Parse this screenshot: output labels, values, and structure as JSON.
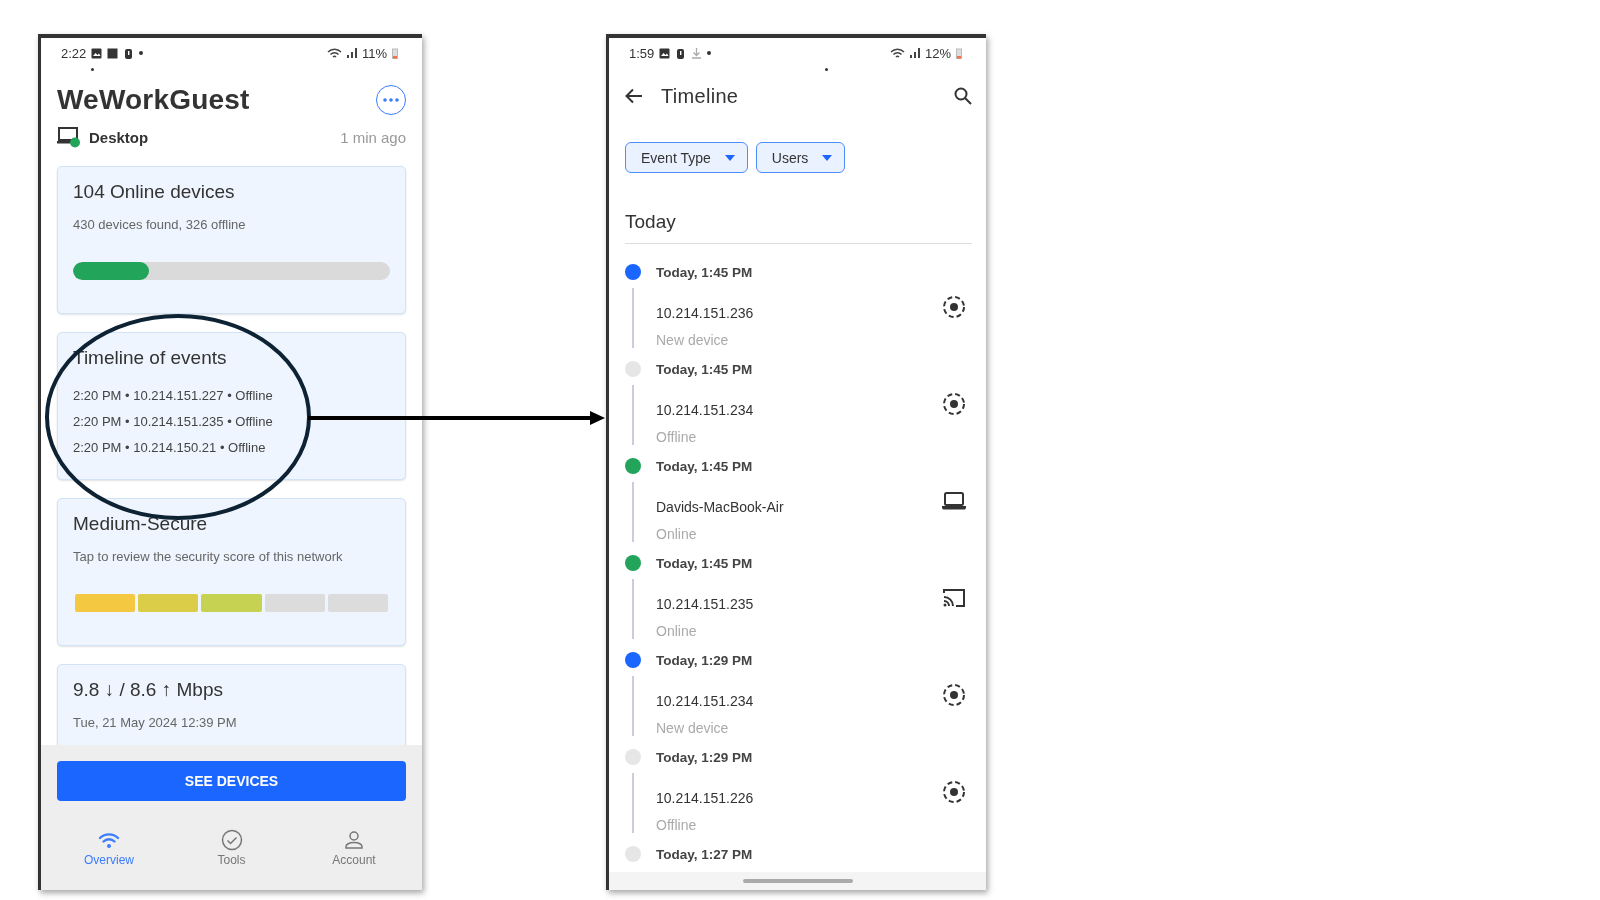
{
  "overview_screen": {
    "status_bar": {
      "time": "2:22",
      "battery": "11%"
    },
    "title": "WeWorkGuest",
    "device": {
      "name": "Desktop",
      "updated": "1 min ago"
    },
    "cards": [
      {
        "kind": "devices",
        "title": "104 Online devices",
        "subtitle": "430 devices found, 326 offline",
        "level": 0.24
      },
      {
        "kind": "timeline",
        "title": "Timeline of events",
        "lines": [
          "2:20 PM • 10.214.151.227 • Offline",
          "2:20 PM • 10.214.151.235 • Offline",
          "2:20 PM • 10.214.150.21 • Offline"
        ]
      },
      {
        "kind": "security",
        "title": "Medium-Secure",
        "subtitle": "Tap to review the security score of this network",
        "segments": [
          {
            "color": "#f5c842"
          },
          {
            "color": "#dccd48"
          },
          {
            "color": "#c5d252"
          },
          {
            "color": "#dcdcdc"
          },
          {
            "color": "#dcdcdc"
          }
        ]
      },
      {
        "kind": "speed",
        "title": "9.8 ↓ / 8.6 ↑ Mbps",
        "subtitle": "Tue, 21 May 2024 12:39 PM"
      }
    ],
    "primary_button": "SEE DEVICES",
    "nav": [
      {
        "label": "Overview",
        "kind": "wifi",
        "selected": true
      },
      {
        "label": "Tools",
        "kind": "check",
        "selected": false
      },
      {
        "label": "Account",
        "kind": "person",
        "selected": false
      }
    ]
  },
  "timeline_screen": {
    "status_bar": {
      "time": "1:59",
      "battery": "12%"
    },
    "title": "Timeline",
    "filters": [
      "Event Type",
      "Users"
    ],
    "section": "Today",
    "events": [
      {
        "time": "Today, 1:45 PM",
        "device": "10.214.151.236",
        "event": "New device",
        "color": "#1a66ff",
        "kind": "radar"
      },
      {
        "time": "Today, 1:45 PM",
        "device": "10.214.151.234",
        "event": "Offline",
        "color": "#e6e6e6",
        "kind": "radar"
      },
      {
        "time": "Today, 1:45 PM",
        "device": "Davids-MacBook-Air",
        "event": "Online",
        "color": "#22a55a",
        "kind": "laptop"
      },
      {
        "time": "Today, 1:45 PM",
        "device": "10.214.151.235",
        "event": "Online",
        "color": "#22a55a",
        "kind": "cast"
      },
      {
        "time": "Today, 1:29 PM",
        "device": "10.214.151.234",
        "event": "New device",
        "color": "#1a66ff",
        "kind": "radar"
      },
      {
        "time": "Today, 1:29 PM",
        "device": "10.214.151.226",
        "event": "Offline",
        "color": "#e6e6e6",
        "kind": "radar"
      },
      {
        "time": "Today, 1:27 PM",
        "color": "#e6e6e6"
      }
    ]
  }
}
